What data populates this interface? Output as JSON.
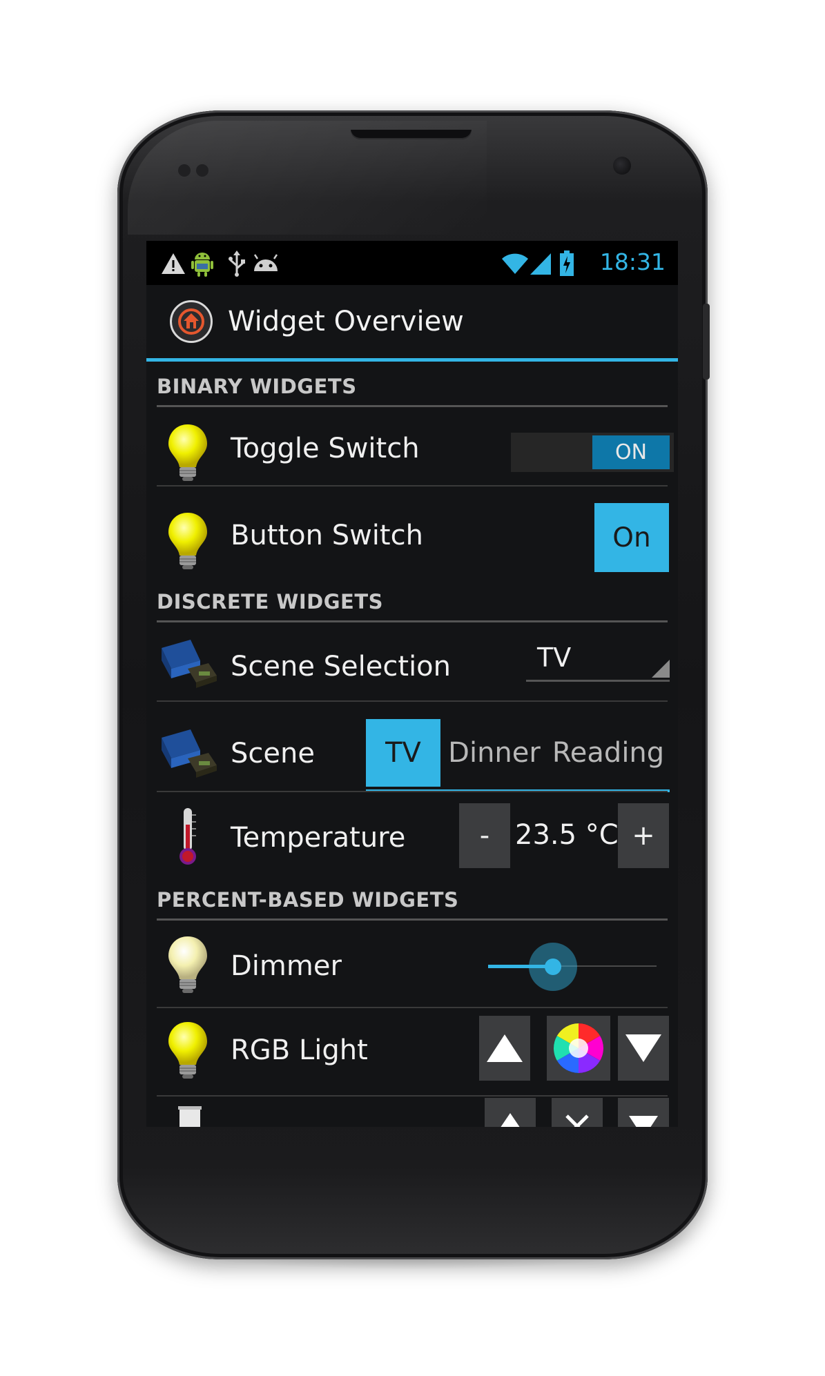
{
  "status_bar": {
    "time": "18:31",
    "icons": [
      "warning-icon",
      "android-robot-icon",
      "usb-icon",
      "android-debug-icon",
      "wifi-icon",
      "signal-icon",
      "battery-charging-icon"
    ],
    "accent": "#33b5e5"
  },
  "action_bar": {
    "title": "Widget Overview",
    "app_icon": "openhab-house-icon"
  },
  "sections": {
    "binary": "BINARY WIDGETS",
    "discrete": "DISCRETE WIDGETS",
    "percent": "PERCENT-BASED WIDGETS"
  },
  "rows": {
    "toggle_switch": {
      "label": "Toggle Switch",
      "state": "ON",
      "icon": "lightbulb-icon"
    },
    "button_switch": {
      "label": "Button Switch",
      "button": "On",
      "icon": "lightbulb-icon"
    },
    "scene_selection": {
      "label": "Scene Selection",
      "value": "TV",
      "icon": "sofa-icon"
    },
    "scene": {
      "label": "Scene",
      "options": [
        "TV",
        "Dinner",
        "Reading"
      ],
      "selected": "TV",
      "icon": "sofa-icon"
    },
    "temperature": {
      "label": "Temperature",
      "value": "23.5 °C",
      "minus": "-",
      "plus": "+",
      "icon": "thermometer-icon"
    },
    "dimmer": {
      "label": "Dimmer",
      "level_percent": 38,
      "icon": "lightbulb-dim-icon"
    },
    "rgb_light": {
      "label": "RGB Light",
      "icon": "lightbulb-icon",
      "controls": [
        "up-arrow-icon",
        "color-wheel-icon",
        "down-arrow-icon"
      ]
    },
    "rollershutter": {
      "icon": "window-blind-icon",
      "controls": [
        "up-arrow-icon",
        "stop-x-icon",
        "down-arrow-icon"
      ]
    }
  },
  "colors": {
    "accent": "#33b5e5",
    "background": "#131416",
    "button_grey": "#3c3d3f"
  }
}
